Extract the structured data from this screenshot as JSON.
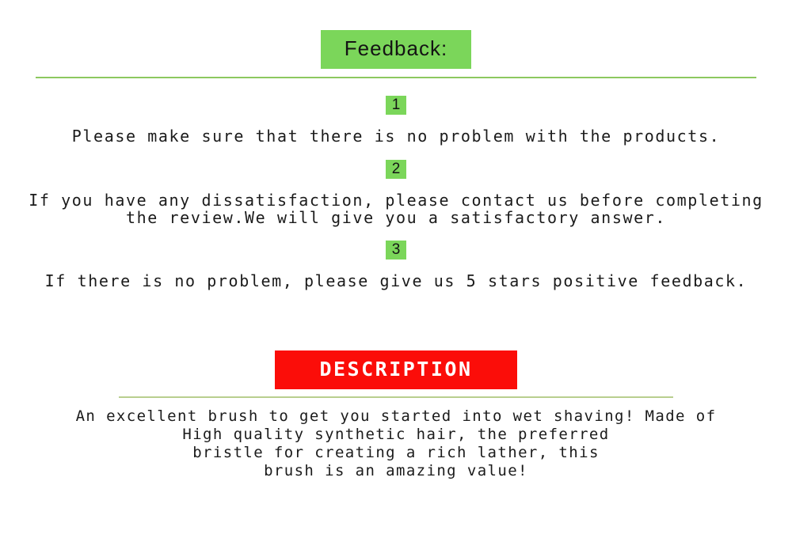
{
  "feedback": {
    "header_label": "Feedback:",
    "header_bg": "#7bd65a",
    "divider_color": "#8cc85f",
    "items": [
      {
        "number": "1",
        "text": "Please make sure that there is no problem with the products."
      },
      {
        "number": "2",
        "text": "If you have any dissatisfaction, please contact us before completing\nthe review.We will give you a satisfactory answer."
      },
      {
        "number": "3",
        "text": "If there is no problem, please give us 5 stars positive feedback."
      }
    ]
  },
  "description": {
    "header_label": "DESCRIPTION",
    "header_bg": "#fb0d09",
    "header_text_color": "#ffffff",
    "divider_color": "#b9cf8e",
    "text": "An excellent brush to get you started into wet shaving! Made of\nHigh quality synthetic hair, the preferred\nbristle for creating a rich lather, this\nbrush is an amazing value!"
  }
}
